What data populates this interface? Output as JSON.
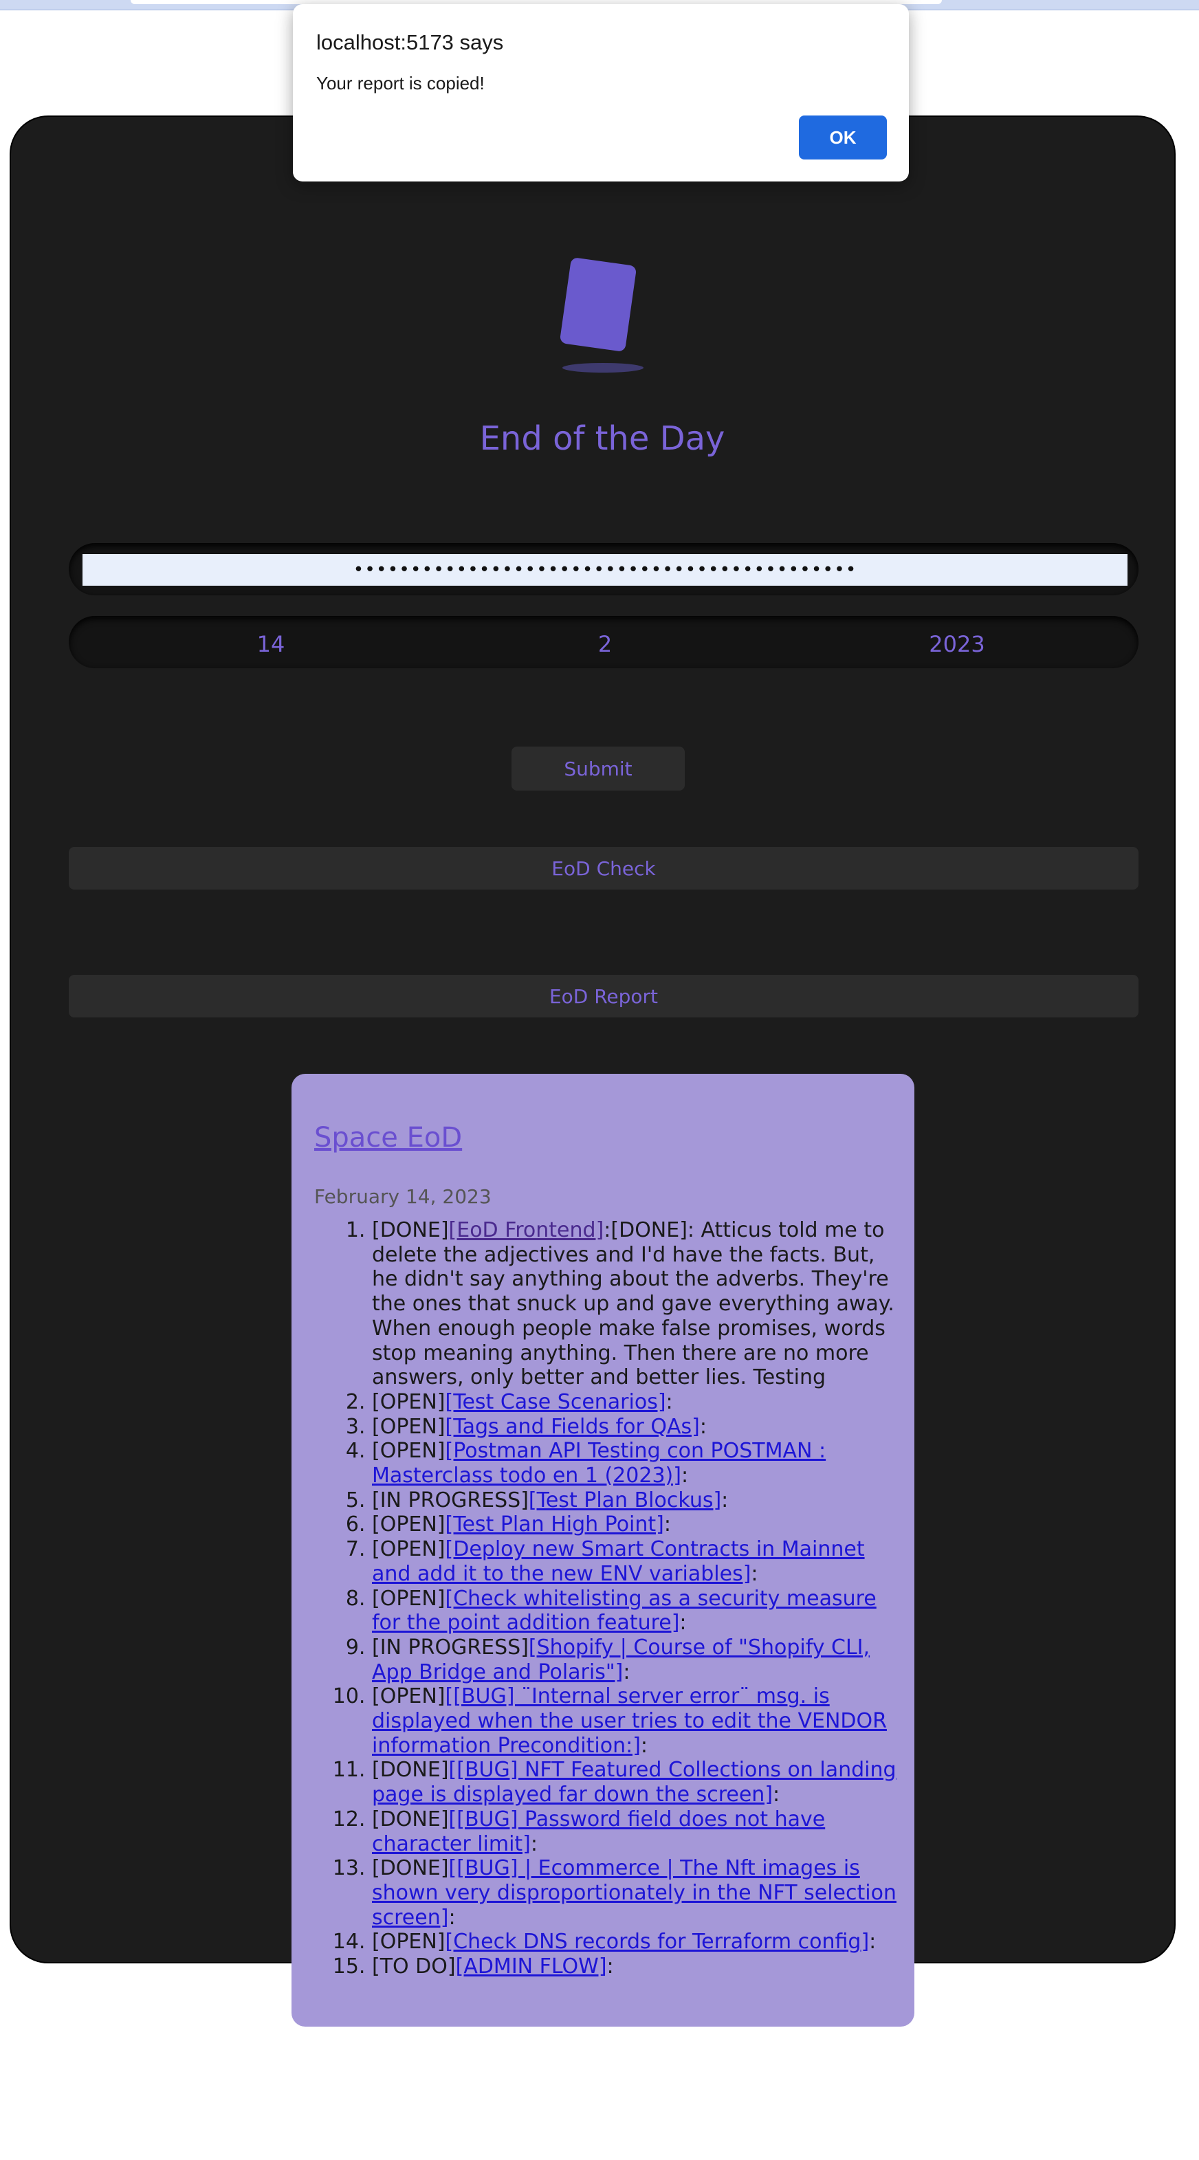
{
  "dialog": {
    "title": "localhost:5173 says",
    "message": "Your report is copied!",
    "ok_label": "OK"
  },
  "app": {
    "title": "End of the Day",
    "password_value": "••••••••••••••••••••••••••••••••••••••••••••",
    "date": {
      "day": "14",
      "month": "2",
      "year": "2023"
    },
    "submit_label": "Submit",
    "eod_check_label": "EoD Check",
    "eod_report_label": "EoD Report"
  },
  "report": {
    "title": "Space EoD",
    "date": "February 14, 2023",
    "items": [
      {
        "num": "1.",
        "status": "[DONE]",
        "link": "[EoD Frontend]",
        "rest": ":[DONE]: Atticus told me to delete the adjectives and I'd have the facts. But, he didn't say anything about the adverbs. They're the ones that snuck up and gave everything away. When enough people make false promises, words stop meaning anything. Then there are no more answers, only better and better lies. Testing",
        "visited": true
      },
      {
        "num": "2.",
        "status": "[OPEN]",
        "link": "[Test Case Scenarios]",
        "rest": ":"
      },
      {
        "num": "3.",
        "status": "[OPEN]",
        "link": "[Tags and Fields for QAs]",
        "rest": ":"
      },
      {
        "num": "4.",
        "status": "[OPEN]",
        "link": "[Postman API Testing con POSTMAN : Masterclass todo en 1 (2023)]",
        "rest": ":"
      },
      {
        "num": "5.",
        "status": "[IN PROGRESS]",
        "link": "[Test Plan Blockus]",
        "rest": ":"
      },
      {
        "num": "6.",
        "status": "[OPEN]",
        "link": "[Test Plan High Point]",
        "rest": ":"
      },
      {
        "num": "7.",
        "status": "[OPEN]",
        "link": "[Deploy new Smart Contracts in Mainnet and add it to the new ENV variables]",
        "rest": ":"
      },
      {
        "num": "8.",
        "status": "[OPEN]",
        "link": "[Check whitelisting as a security measure for the point addition feature]",
        "rest": ":"
      },
      {
        "num": "9.",
        "status": "[IN PROGRESS]",
        "link": "[Shopify | Course of \"Shopify CLI, App Bridge and Polaris\"]",
        "rest": ":"
      },
      {
        "num": "10.",
        "status": "[OPEN]",
        "link": "[[BUG] ¨Internal server error¨ msg. is displayed when the user tries to edit the VENDOR information Precondition:]",
        "rest": ":"
      },
      {
        "num": "11.",
        "status": "[DONE]",
        "link": "[[BUG] NFT Featured Collections on landing page is displayed far down the screen]",
        "rest": ":"
      },
      {
        "num": "12.",
        "status": "[DONE]",
        "link": "[[BUG] Password field does not have character limit]",
        "rest": ":"
      },
      {
        "num": "13.",
        "status": "[DONE]",
        "link": "[[BUG] | Ecommerce | The Nft images is shown very disproportionately in the NFT selection screen]",
        "rest": ":"
      },
      {
        "num": "14.",
        "status": "[OPEN]",
        "link": "[Check DNS records for Terraform config]",
        "rest": ":"
      },
      {
        "num": "15.",
        "status": "[TO DO]",
        "link": "[ADMIN FLOW]",
        "rest": ":"
      }
    ]
  }
}
